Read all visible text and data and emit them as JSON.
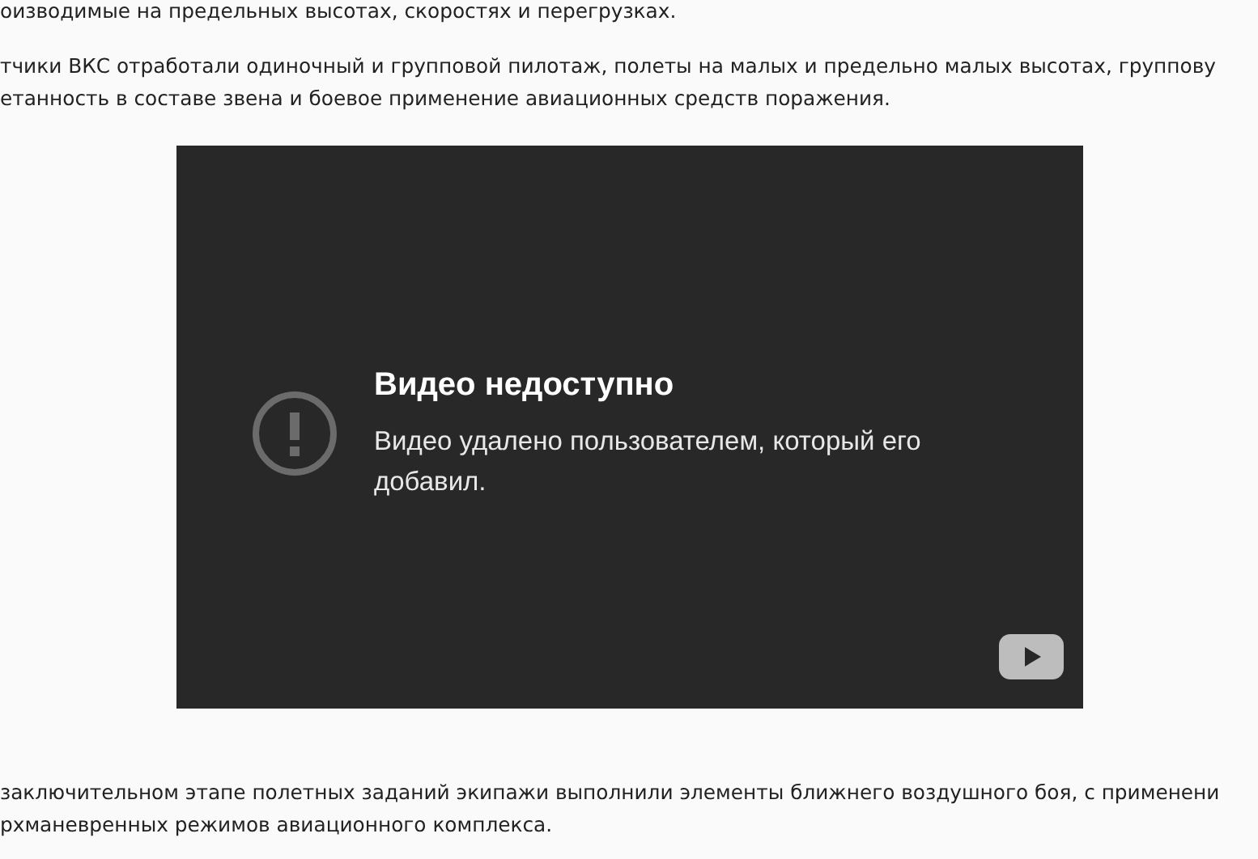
{
  "paragraphs_before": [
    {
      "lines": [
        "оизводимые на предельных высотах, скоростях и перегрузках."
      ]
    },
    {
      "lines": [
        "тчики ВКС отработали одиночный и групповой пилотаж, полеты на малых и предельно малых высотах, группову",
        "етанность в составе звена и боевое применение авиационных средств поражения."
      ]
    }
  ],
  "video": {
    "title": "Видео недоступно",
    "message": "Видео удалено пользователем, который его добавил."
  },
  "paragraphs_after": [
    {
      "lines": [
        "заключительном этапе полетных заданий экипажи выполнили элементы ближнего воздушного боя, с применени",
        "рхманевренных режимов авиационного комплекса."
      ]
    }
  ]
}
